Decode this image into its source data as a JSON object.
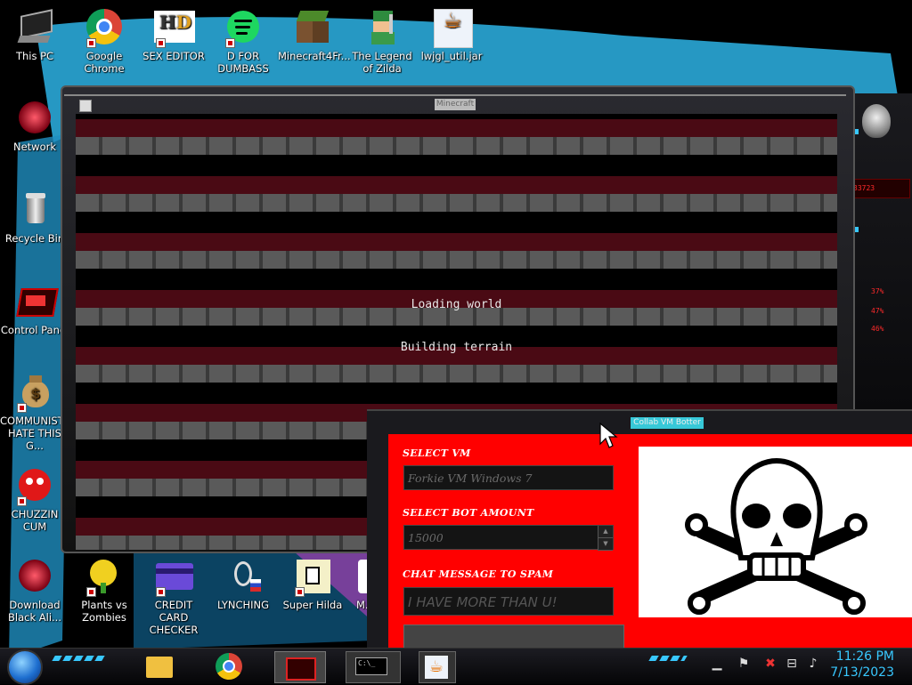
{
  "desktop_icons": [
    {
      "label": "This PC",
      "icon": "this-pc-icon"
    },
    {
      "label": "Google Chrome",
      "icon": "chrome-icon"
    },
    {
      "label": "SEX EDITOR",
      "icon": "hxd-icon"
    },
    {
      "label": "D FOR DUMBASS",
      "icon": "spotify-icon"
    },
    {
      "label": "Minecraft4Fr...",
      "icon": "minecraft-icon"
    },
    {
      "label": "The Legend of Zilda",
      "icon": "zelda-icon"
    },
    {
      "label": "lwjgl_util.jar",
      "icon": "java-icon"
    },
    {
      "label": "Network",
      "icon": "network-alien-icon"
    },
    {
      "label": "Recycle Bin",
      "icon": "recycle-bin-icon"
    },
    {
      "label": "Control Panel",
      "icon": "control-panel-icon"
    },
    {
      "label": "COMMUNISTS HATE THIS G...",
      "icon": "money-bag-icon"
    },
    {
      "label": "CHUZZIN CUM",
      "icon": "chuzzle-icon"
    },
    {
      "label": "Download Black Ali...",
      "icon": "alien-download-icon"
    },
    {
      "label": "Plants vs Zombies",
      "icon": "pvz-icon"
    },
    {
      "label": "CREDIT CARD CHECKER",
      "icon": "credit-card-icon"
    },
    {
      "label": "LYNCHING",
      "icon": "noose-icon"
    },
    {
      "label": "Super Hilda",
      "icon": "hilda-icon"
    },
    {
      "label": "M...",
      "icon": "app-icon"
    }
  ],
  "minecraft_window": {
    "title": "Minecraft",
    "loading_line1": "Loading world",
    "loading_line2": "Building terrain"
  },
  "bot_window": {
    "title": "Collab VM Botter",
    "select_vm_label": "SELECT VM",
    "select_vm_value": "Forkie VM Windows 7",
    "bot_amount_label": "SELECT BOT AMOUNT",
    "bot_amount_value": "15000",
    "chat_label": "CHAT MESSAGE TO SPAM",
    "chat_value": "I HAVE MORE THAN U!"
  },
  "alien_gadget": {
    "meter_1": "33723",
    "pct_1": "37%",
    "pct_2": "47%",
    "pct_3": "46%"
  },
  "taskbar": {
    "pinned": [
      "file-explorer-icon",
      "chrome-icon",
      "alien-app-icon",
      "cmd-icon",
      "java-icon"
    ],
    "cmd_text": "C:\\_"
  },
  "clock": {
    "time": "11:26 PM",
    "date": "7/13/2023"
  },
  "colors": {
    "accent": "#38c8ff",
    "bot_bg": "#ff0000",
    "mc_stripe": "#4a0a14"
  }
}
